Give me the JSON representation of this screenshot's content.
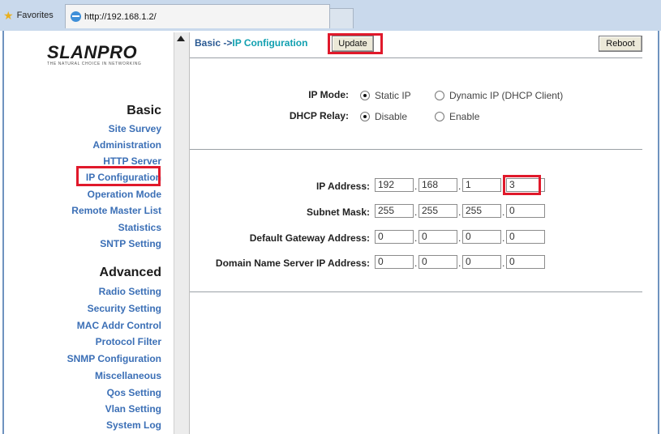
{
  "browser": {
    "favorites_label": "Favorites",
    "tab_url": "http://192.168.1.2/"
  },
  "brand": {
    "logo_text": "LANPRO",
    "logo_prefix": "S",
    "tagline": "THE NATURAL CHOICE IN NETWORKING"
  },
  "sidebar": {
    "basic_title": "Basic",
    "basic_items": [
      "Site Survey",
      "Administration",
      "HTTP Server",
      "IP Configuration",
      "Operation Mode",
      "Remote Master List",
      "Statistics",
      "SNTP Setting"
    ],
    "advanced_title": "Advanced",
    "advanced_items": [
      "Radio Setting",
      "Security Setting",
      "MAC Addr Control",
      "Protocol Filter",
      "SNMP Configuration",
      "Miscellaneous",
      "Qos Setting",
      "Vlan Setting",
      "System Log"
    ],
    "highlighted_item": "IP Configuration"
  },
  "header": {
    "breadcrumb_prefix": "Basic ->",
    "breadcrumb_current": "IP Configuration",
    "update_label": "Update",
    "reboot_label": "Reboot"
  },
  "ip_mode": {
    "label": "IP Mode:",
    "options": [
      "Static IP",
      "Dynamic IP (DHCP Client)"
    ],
    "selected": "Static IP"
  },
  "dhcp_relay": {
    "label": "DHCP Relay:",
    "options": [
      "Disable",
      "Enable"
    ],
    "selected": "Disable"
  },
  "ip_fields": [
    {
      "label": "IP Address:",
      "octets": [
        "192",
        "168",
        "1",
        "3"
      ]
    },
    {
      "label": "Subnet Mask:",
      "octets": [
        "255",
        "255",
        "255",
        "0"
      ]
    },
    {
      "label": "Default Gateway Address:",
      "octets": [
        "0",
        "0",
        "0",
        "0"
      ]
    },
    {
      "label": "Domain Name Server IP Address:",
      "octets": [
        "0",
        "0",
        "0",
        "0"
      ]
    }
  ],
  "colors": {
    "highlight": "#e0192b",
    "link": "#3b6fb6",
    "breadcrumb_current": "#11a0b0"
  }
}
